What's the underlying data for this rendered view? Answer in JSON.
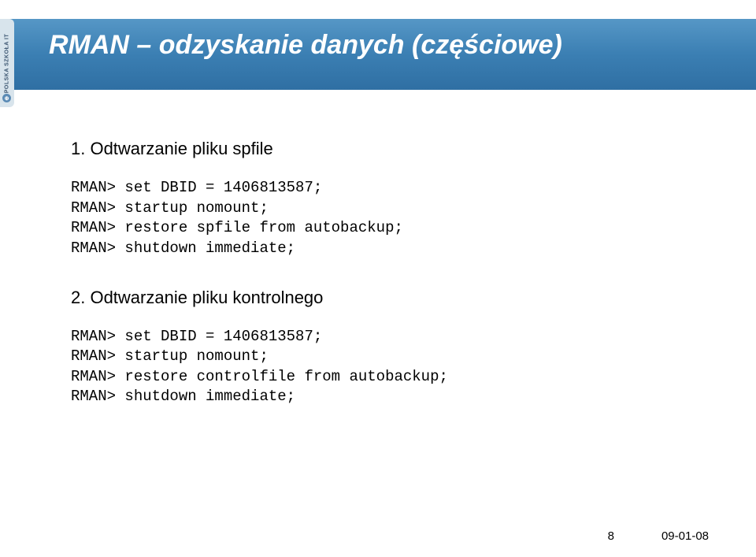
{
  "sidebar": {
    "brand": "POLSKA SZKOŁA IT",
    "icon_glyph": "⊕"
  },
  "header": {
    "title": "RMAN – odzyskanie danych (częściowe)"
  },
  "sections": [
    {
      "heading": "1. Odtwarzanie pliku spfile",
      "code": "RMAN> set DBID = 1406813587;\nRMAN> startup nomount;\nRMAN> restore spfile from autobackup;\nRMAN> shutdown immediate;"
    },
    {
      "heading": "2. Odtwarzanie pliku kontrolnego",
      "code": "RMAN> set DBID = 1406813587;\nRMAN> startup nomount;\nRMAN> restore controlfile from autobackup;\nRMAN> shutdown immediate;"
    }
  ],
  "footer": {
    "page": "8",
    "date": "09-01-08"
  }
}
